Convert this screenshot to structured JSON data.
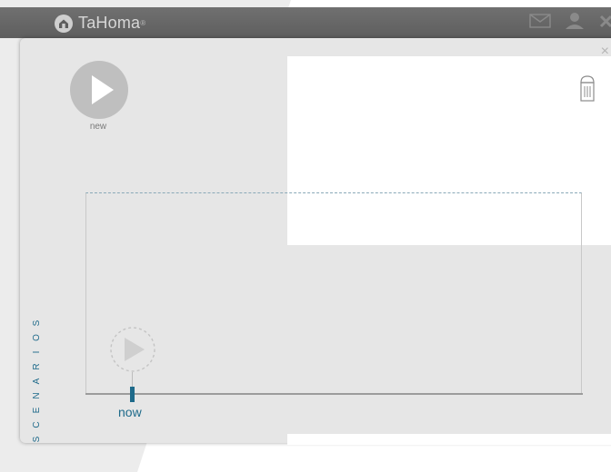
{
  "header": {
    "brand": "TaHoma",
    "registered": "®",
    "icons": [
      "mail-icon",
      "user-icon",
      "close-icon"
    ]
  },
  "panel": {
    "close_symbol": "×"
  },
  "new_scenario": {
    "label": "new",
    "icon": "play-icon"
  },
  "editor": {
    "trash_icon": "trash-icon"
  },
  "timeline": {
    "now_label": "now",
    "play_icon": "play-icon"
  },
  "sidebar": {
    "vertical_label": "SCENARIOS"
  },
  "colors": {
    "accent": "#1e6a8a",
    "header": "#666666",
    "panel": "#e6e6e6"
  }
}
